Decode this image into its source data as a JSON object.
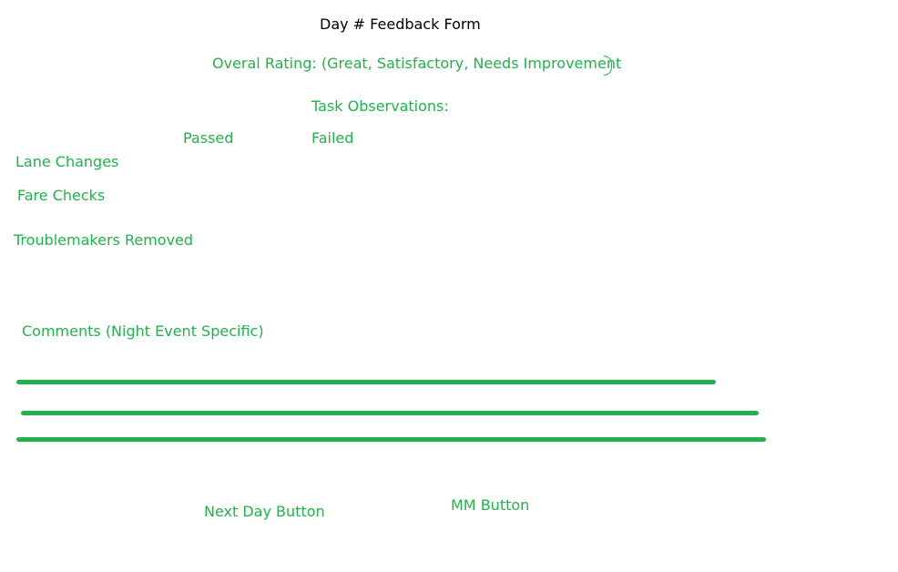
{
  "form": {
    "title": "Day # Feedback Form",
    "overall_rating": "Overal Rating: (Great, Satisfactory, Needs Improvement",
    "task_observations": "Task Observations:",
    "columns": {
      "passed": "Passed",
      "failed": "Failed"
    },
    "tasks": [
      {
        "label": "Lane Changes"
      },
      {
        "label": "Fare Checks"
      },
      {
        "label": "Troublemakers Removed"
      }
    ],
    "comments_label": "Comments (Night Event Specific)",
    "buttons": {
      "next_day": "Next Day Button",
      "mm": "MM Button"
    }
  },
  "colors": {
    "accent": "#22b14c",
    "title_text": "#000000",
    "background": "#ffffff"
  }
}
